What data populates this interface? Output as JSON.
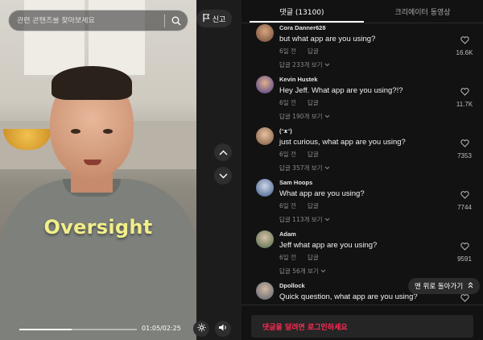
{
  "search": {
    "placeholder": "관련 콘텐츠를 찾아보세요"
  },
  "video": {
    "overlay_text": "Oversight",
    "time": "01:05/02:25",
    "progress_fraction": 0.448
  },
  "actions": {
    "report_label": "신고"
  },
  "tabs": [
    {
      "label": "댓글 (13100)",
      "active": true
    },
    {
      "label": "크리에이터 동영상",
      "active": false
    }
  ],
  "comments": [
    {
      "username": "Cora Danner628",
      "text": "but what app are you using?",
      "age": "6일 전",
      "reply": "답글",
      "replies": "답글 233개 보기",
      "likes": "16.6K"
    },
    {
      "username": "Kevin Hustek",
      "text": "Hey Jeff. What app are you using?!?",
      "age": "6일 전",
      "reply": "답글",
      "replies": "답글 190개 보기",
      "likes": "11.7K"
    },
    {
      "username": "(ᵔᴥᵔ)",
      "text": "just curious, what app are you using?",
      "age": "6일 전",
      "reply": "답글",
      "replies": "답글 357개 보기",
      "likes": "7353"
    },
    {
      "username": "Sam Hoops",
      "text": "What app are you using?",
      "age": "6일 전",
      "reply": "답글",
      "replies": "답글 113개 보기",
      "likes": "7744"
    },
    {
      "username": "Adam",
      "text": "Jeff what app are you using?",
      "age": "6일 전",
      "reply": "답글",
      "replies": "답글 56개 보기",
      "likes": "9591"
    },
    {
      "username": "Dpollock",
      "text": "Quick question, what app are you using?",
      "age": "",
      "reply": "",
      "replies": "",
      "likes": ""
    }
  ],
  "back_to_top": {
    "label": "맨 위로 돌아가기"
  },
  "login_prompt": "댓글을 달려면 로그인하세요",
  "icons": {
    "search": "search-icon",
    "report": "flag-icon",
    "up": "chevron-up-icon",
    "down": "chevron-down-icon",
    "like": "heart-icon",
    "expand": "chevron-down-icon",
    "volume": "volume-icon",
    "speed": "gear-icon"
  },
  "colors": {
    "accent": "#fe2c55",
    "overlay": "#f2ee8a"
  }
}
